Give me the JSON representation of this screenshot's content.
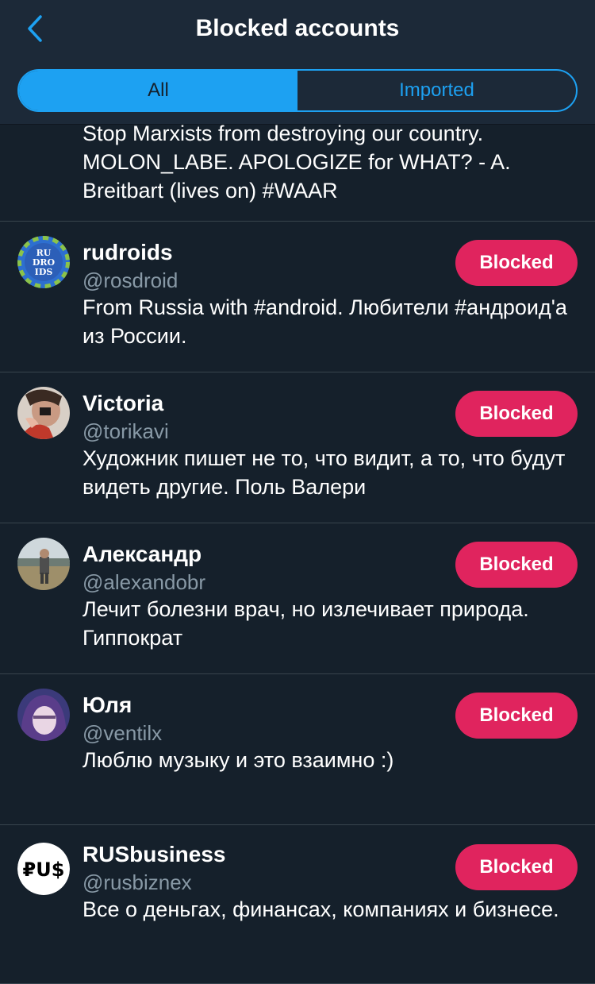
{
  "header": {
    "title": "Blocked accounts",
    "back_icon": "chevron-left-icon",
    "tabs": [
      {
        "label": "All",
        "active": true
      },
      {
        "label": "Imported",
        "active": false
      }
    ]
  },
  "colors": {
    "accent": "#1da1f2",
    "blocked": "#e0245e",
    "background": "#15202b",
    "header": "#1c2938",
    "secondary_text": "#8899a6"
  },
  "partial_bio": "Stop Marxists from destroying our country. MOLON_LABE. APOLOGIZE for WHAT? - A. Breitbart (lives on) #WAAR",
  "accounts": [
    {
      "name": "rudroids",
      "handle": "@rosdroid",
      "bio": "From Russia with #android. Любители #андроид'а из России.",
      "button": "Blocked",
      "avatar_text": [
        "RU",
        "DRO",
        "IDS"
      ]
    },
    {
      "name": "Victoria",
      "handle": "@torikavi",
      "bio": "Художник пишет не то, что видит, а то, что будут видеть другие. Поль Валери",
      "button": "Blocked"
    },
    {
      "name": "Александр",
      "handle": "@alexandobr",
      "bio": "Лечит болезни врач, но излечивает природа. Гиппократ",
      "button": "Blocked"
    },
    {
      "name": "Юля",
      "handle": "@ventilx",
      "bio": "Люблю музыку и это взаимно :)",
      "button": "Blocked"
    },
    {
      "name": "RUSbusiness",
      "handle": "@rusbiznex",
      "bio": "Все о деньгах, финансах, компаниях и бизнесе.",
      "button": "Blocked",
      "avatar_text": [
        "₽U$"
      ]
    }
  ]
}
